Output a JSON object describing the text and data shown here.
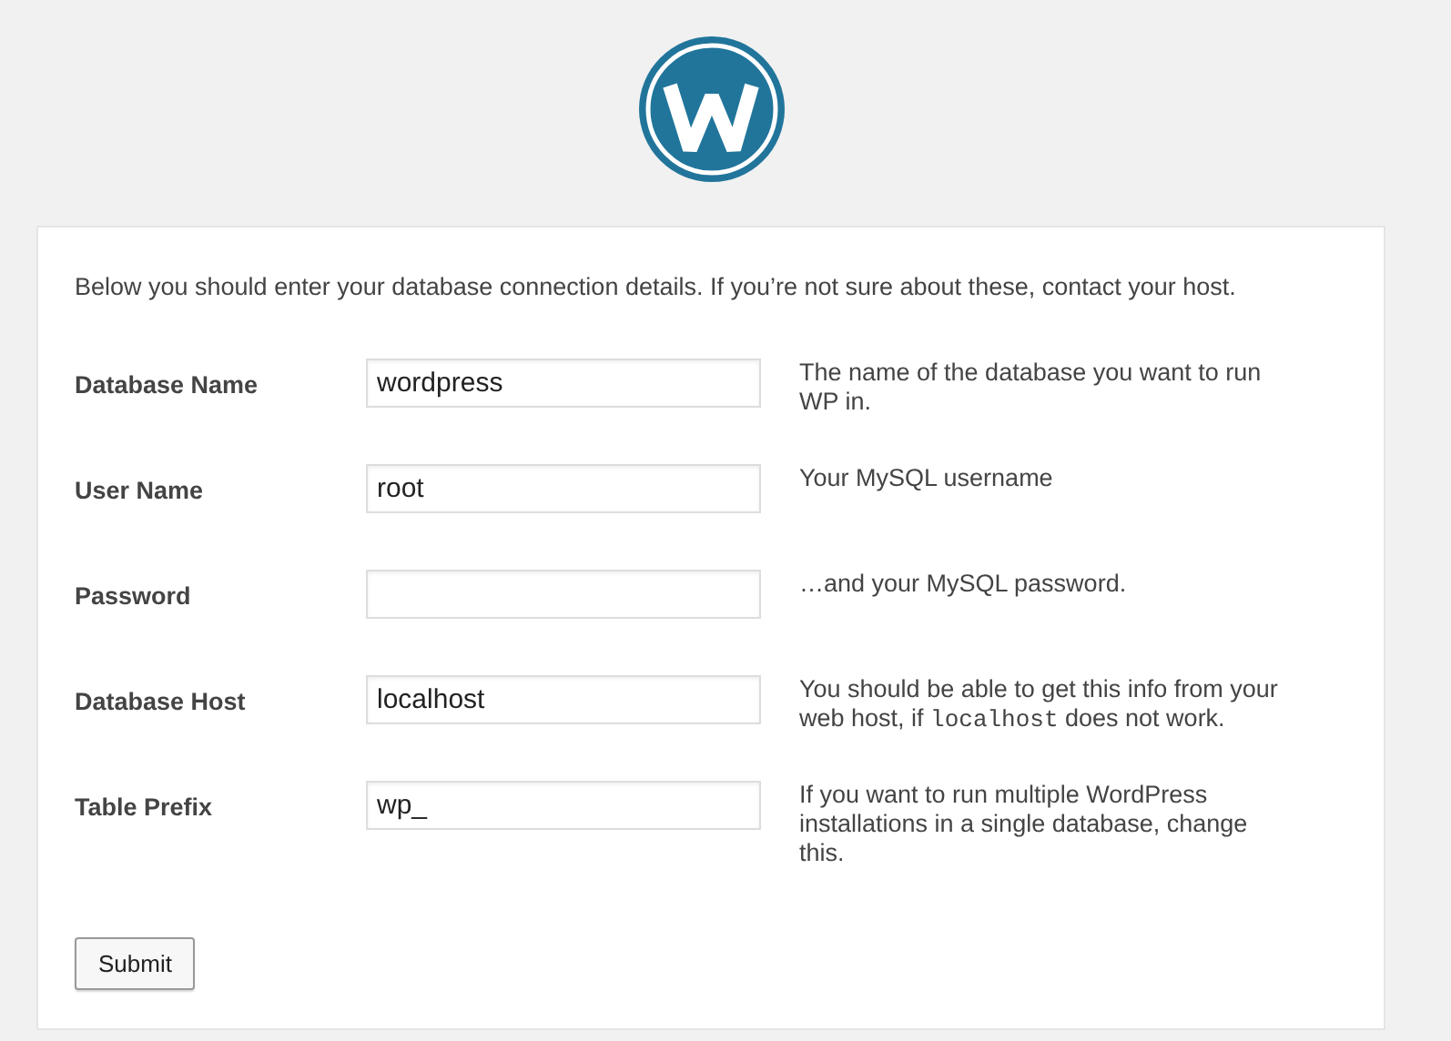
{
  "intro": "Below you should enter your database connection details. If you’re not sure about these, contact your host.",
  "fields": [
    {
      "label": "Database Name",
      "value": "wordpress",
      "help": [
        {
          "kind": "text",
          "text": "The name of the database you want to run WP in."
        }
      ]
    },
    {
      "label": "User Name",
      "value": "root",
      "help": [
        {
          "kind": "text",
          "text": "Your MySQL username"
        }
      ]
    },
    {
      "label": "Password",
      "help": [
        {
          "kind": "text",
          "text": "…and your MySQL password."
        }
      ]
    },
    {
      "label": "Database Host",
      "value": "localhost",
      "help": [
        {
          "kind": "text",
          "text": "You should be able to get this info from your web host, if "
        },
        {
          "kind": "code",
          "text": "localhost"
        },
        {
          "kind": "text",
          "text": " does not work."
        }
      ]
    },
    {
      "label": "Table Prefix",
      "value": "wp_",
      "help": [
        {
          "kind": "text",
          "text": "If you want to run multiple WordPress installations in a single database, change this."
        }
      ]
    }
  ],
  "submit": "Submit"
}
